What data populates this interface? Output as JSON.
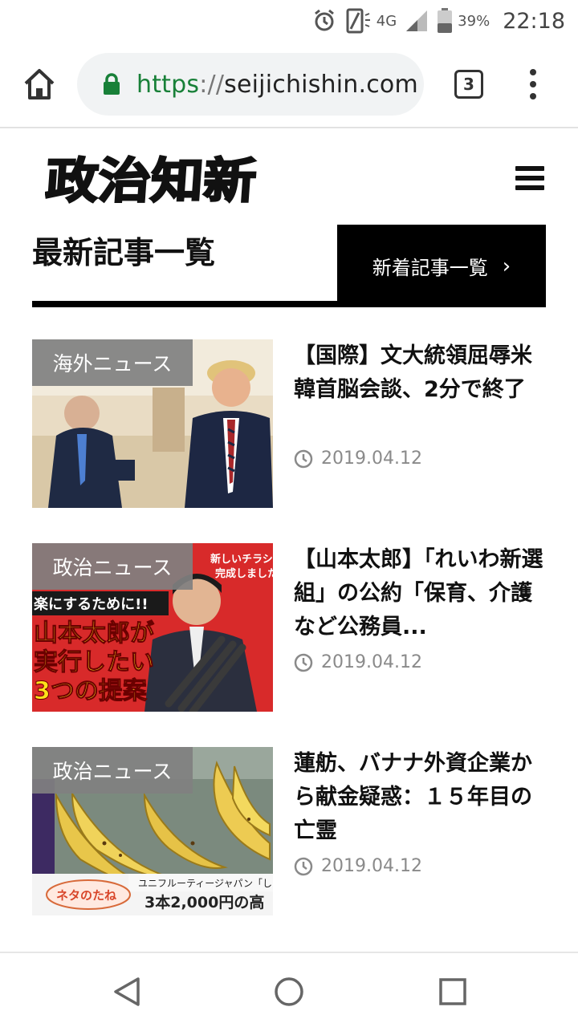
{
  "status_bar": {
    "network": "4G",
    "battery": "39%",
    "time": "22:18",
    "icons": [
      "alarm-icon",
      "screen-rotation-icon",
      "network-signal-icon",
      "battery-icon"
    ]
  },
  "browser": {
    "url_scheme": "https",
    "url_separator": "://",
    "url_host": "seijichishin.com",
    "tab_count": "3"
  },
  "site": {
    "logo_text": "政治知新"
  },
  "section": {
    "title": "最新記事一覧",
    "link_label": "新着記事一覧",
    "link_chevron": "›"
  },
  "articles": [
    {
      "category": "海外ニュース",
      "title": "【国際】文大統領屈辱米韓首脳会談、2分で終了",
      "date": "2019.04.12"
    },
    {
      "category": "政治ニュース",
      "title": "【山本太郎】「れいわ新選組」の公約「保育、介護など公務員...",
      "date": "2019.04.12",
      "image_text": {
        "top_right": "新しいチラシ",
        "top_right2": "完成しました",
        "subtitle": "楽にするために!!",
        "headline1": "山本太郎が",
        "headline2": "実行したい",
        "headline3": "3つの提案"
      }
    },
    {
      "category": "政治ニュース",
      "title": "蓮舫、バナナ外資企業から献金疑惑：１５年目の亡霊",
      "date": "2019.04.12",
      "image_text": {
        "caption_top": "ユニフルーティージャパン「し",
        "caption_bottom": "3本2,000円の高",
        "brand": "ネタのたね"
      }
    }
  ],
  "colors": {
    "url_scheme": "#188038",
    "category_badge": "#808080",
    "section_link_bg": "#000000",
    "date_text": "#8a8a8a"
  }
}
